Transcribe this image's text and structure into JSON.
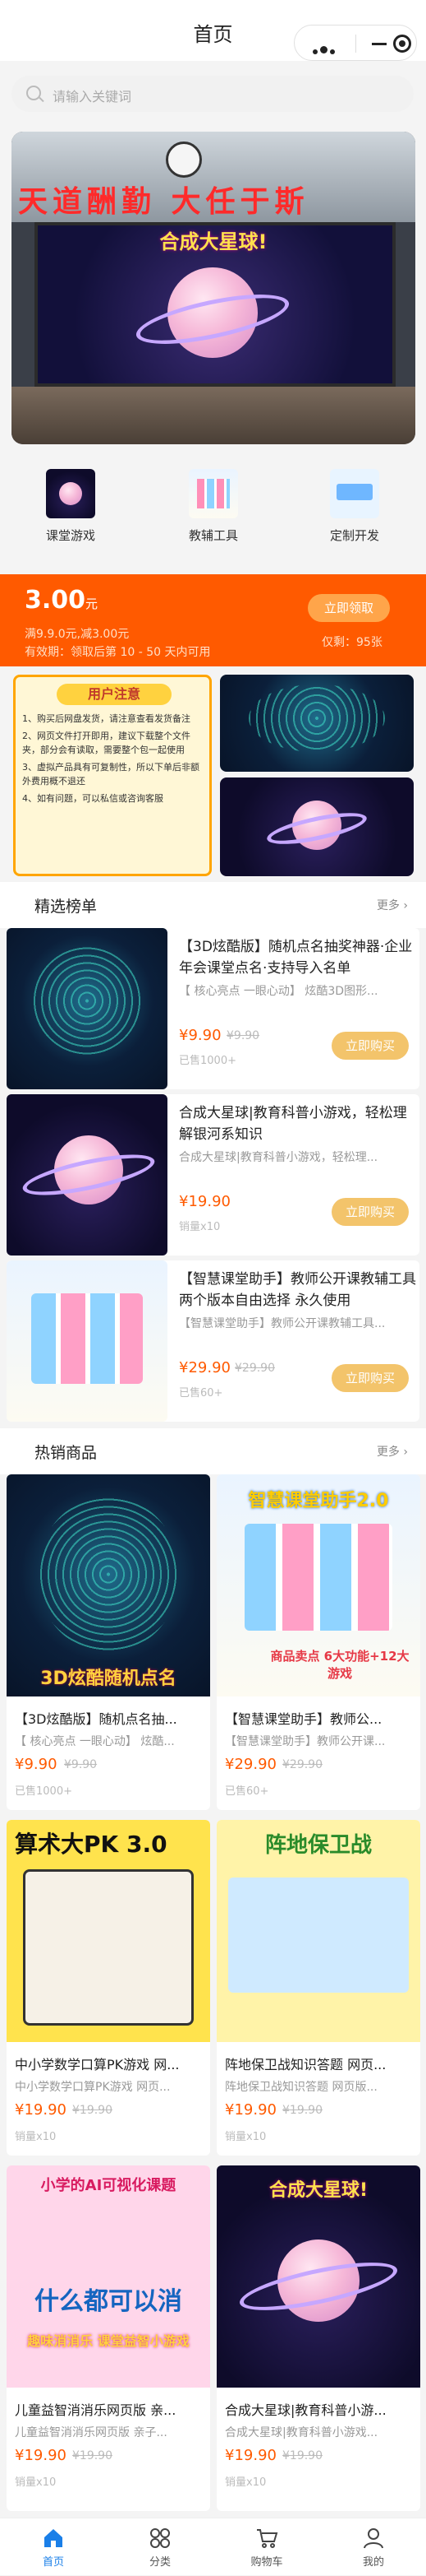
{
  "header": {
    "title": "首页"
  },
  "search": {
    "placeholder": "请输入关键词"
  },
  "banner": {
    "headline": "天道酬勤 大任于斯",
    "badge": "合成大星球!"
  },
  "categories": [
    {
      "label": "课堂游戏"
    },
    {
      "label": "教辅工具"
    },
    {
      "label": "定制开发"
    }
  ],
  "coupon": {
    "amount": "3.00",
    "unit": "元",
    "condition": "满9.9.0元,减3.00元",
    "validity": "有效期：领取后第 10 - 50 天内可用",
    "button": "立即领取",
    "remaining": "仅剩：95张"
  },
  "notice": {
    "title": "用户注意",
    "lines": [
      "1、购买后网盘发货，请注意查看发货备注",
      "2、网页文件打开即用，建议下载整个文件夹，部分会有读取，需要整个包一起使用",
      "3、虚拟产品具有可复制性，所以下单后非额外费用概不退还",
      "4、如有问题，可以私信或咨询客服"
    ]
  },
  "featured": {
    "title": "精选榜单",
    "more": "更多",
    "items": [
      {
        "name": "【3D炫酷版】随机点名抽奖神器·企业年会课堂点名·支持导入名单",
        "sub": "【 核心亮点 一眼心动】 炫酷3D图形...",
        "price": "¥9.90",
        "orig": "¥9.90",
        "sold": "已售1000+",
        "buy": "立即购买"
      },
      {
        "name": "合成大星球|教育科普小游戏，轻松理解银河系知识",
        "sub": "合成大星球|教育科普小游戏，轻松理...",
        "price": "¥19.90",
        "orig": "",
        "sold": "销量x10",
        "buy": "立即购买"
      },
      {
        "name": "【智慧课堂助手】教师公开课教辅工具 两个版本自由选择 永久使用",
        "sub": "【智慧课堂助手】教师公开课教辅工具...",
        "price": "¥29.90",
        "orig": "¥29.90",
        "sold": "已售60+",
        "buy": "立即购买"
      }
    ]
  },
  "hot": {
    "title": "热销商品",
    "more": "更多",
    "items": [
      {
        "name": "【3D炫酷版】随机点名抽...",
        "sub": "【 核心亮点 一眼心动】 炫酷...",
        "price": "¥9.90",
        "orig": "¥9.90",
        "sold": "已售1000+",
        "img_text": "3D炫酷随机点名"
      },
      {
        "name": "【智慧课堂助手】教师公...",
        "sub": "【智慧课堂助手】教师公开课...",
        "price": "¥29.90",
        "orig": "¥29.90",
        "sold": "已售60+",
        "img_text": "智慧课堂助手2.0",
        "img_text2": "商品卖点 6大功能+12大游戏"
      },
      {
        "name": "中小学数学口算PK游戏 网...",
        "sub": "中小学数学口算PK游戏 网页...",
        "price": "¥19.90",
        "orig": "¥19.90",
        "sold": "销量x10",
        "img_text": "算术大PK 3.0"
      },
      {
        "name": "阵地保卫战知识答题 网页...",
        "sub": "阵地保卫战知识答题 网页版...",
        "price": "¥19.90",
        "orig": "¥19.90",
        "sold": "销量x10",
        "img_text": "阵地保卫战"
      },
      {
        "name": "儿童益智消消乐网页版 亲...",
        "sub": "儿童益智消消乐网页版 亲子...",
        "price": "¥19.90",
        "orig": "¥19.90",
        "sold": "销量x10",
        "img_text": "小学的AI可视化课题",
        "img_text2": "什么都可以消",
        "img_text3": "趣味消消乐 课堂益智小游戏"
      },
      {
        "name": "合成大星球|教育科普小游...",
        "sub": "合成大星球|教育科普小游戏...",
        "price": "¥19.90",
        "orig": "¥19.90",
        "sold": "销量x10",
        "img_text": "合成大星球!"
      }
    ]
  },
  "tabbar": [
    {
      "label": "首页"
    },
    {
      "label": "分类"
    },
    {
      "label": "购物车"
    },
    {
      "label": "我的"
    }
  ],
  "colors": {
    "accent": "#ff5a00",
    "buy": "#f3c46b",
    "tab_active": "#1a7fe8"
  }
}
